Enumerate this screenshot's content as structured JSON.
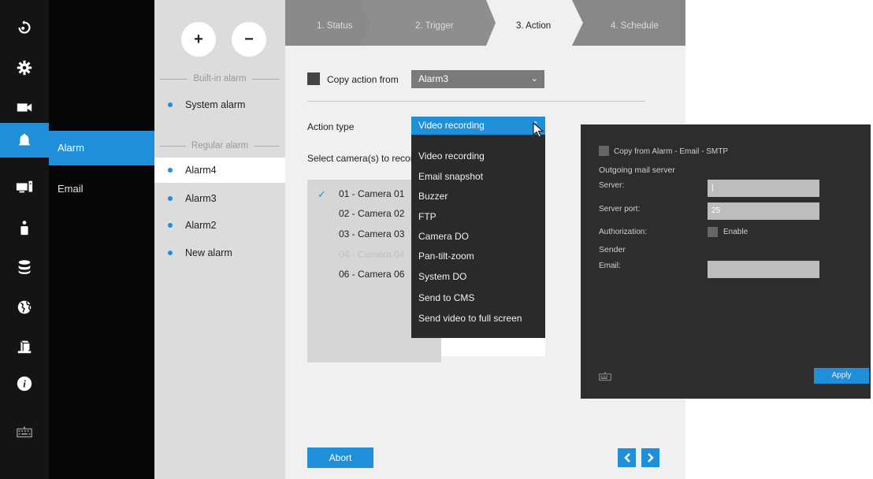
{
  "submenu": {
    "items": [
      "Alarm",
      "Email"
    ]
  },
  "alarm_list": {
    "add_label": "+",
    "remove_label": "−",
    "builtin_heading": "Built-in alarm",
    "builtin_items": [
      "System alarm"
    ],
    "regular_heading": "Regular alarm",
    "regular_items": [
      "Alarm4",
      "Alarm3",
      "Alarm2",
      "New alarm"
    ]
  },
  "steps": [
    "1. Status",
    "2. Trigger",
    "3. Action",
    "4. Schedule"
  ],
  "action": {
    "copy_label": "Copy action from",
    "copy_value": "Alarm3",
    "action_type_label": "Action type",
    "action_type_value": "Video recording",
    "select_cameras_label": "Select camera(s) to record",
    "cameras": [
      {
        "label": "01 - Camera 01",
        "checked": true,
        "disabled": false
      },
      {
        "label": "02 - Camera 02",
        "checked": false,
        "disabled": false
      },
      {
        "label": "03 - Camera 03",
        "checked": false,
        "disabled": false
      },
      {
        "label": "04 - Camera 04",
        "checked": false,
        "disabled": true
      },
      {
        "label": "06 - Camera 06",
        "checked": false,
        "disabled": false
      }
    ],
    "dropdown_options": [
      "Video recording",
      "Email snapshot",
      "Buzzer",
      "FTP",
      "Camera DO",
      "Pan-tilt-zoom",
      "System DO",
      "Send to CMS",
      "Send video to full screen"
    ],
    "abort_label": "Abort"
  },
  "email_panel": {
    "copy_label": "Copy from Alarm - Email - SMTP",
    "outgoing_heading": "Outgoing mail server",
    "server_label": "Server:",
    "server_value": "|",
    "port_label": "Server port:",
    "port_value": "25",
    "auth_label": "Authorization:",
    "enable_label": "Enable",
    "sender_heading": "Sender",
    "email_label": "Email:",
    "email_value": "",
    "apply_label": "Apply"
  },
  "colors": {
    "accent": "#1f8fd9",
    "rail": "#141414",
    "dropdown": "#2a2a2a",
    "email_panel": "#2d2d2d"
  }
}
